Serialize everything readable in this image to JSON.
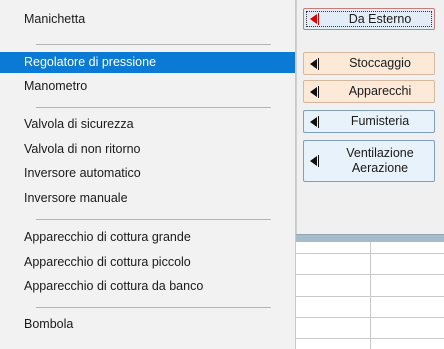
{
  "menu": {
    "items": [
      {
        "label": "Manichetta",
        "selected": false
      },
      {
        "label": "Regolatore di pressione",
        "selected": true
      },
      {
        "label": "Manometro",
        "selected": false
      },
      {
        "label": "Valvola di sicurezza",
        "selected": false
      },
      {
        "label": "Valvola di non ritorno",
        "selected": false
      },
      {
        "label": "Inversore automatico",
        "selected": false
      },
      {
        "label": "Inversore manuale",
        "selected": false
      },
      {
        "label": "Apparecchio di cottura grande",
        "selected": false
      },
      {
        "label": "Apparecchio di cottura piccolo",
        "selected": false
      },
      {
        "label": "Apparecchio di cottura da banco",
        "selected": false
      },
      {
        "label": "Bombola",
        "selected": false
      }
    ]
  },
  "panel": {
    "buttons": [
      {
        "label": "Da Esterno",
        "icon": "left-arrow-icon",
        "active": true
      },
      {
        "label": "Stoccaggio",
        "icon": "left-arrow-icon"
      },
      {
        "label": "Apparecchi",
        "icon": "left-arrow-icon"
      },
      {
        "label": "Fumisteria",
        "icon": "left-arrow-icon"
      },
      {
        "label": "Ventilazione\nAerazione",
        "icon": "left-arrow-icon"
      }
    ]
  },
  "colors": {
    "selection": "#0a7ad4",
    "active_arrow": "#e00000",
    "peach_button": "#fde9d8",
    "blue_button": "#e8f2fb"
  }
}
